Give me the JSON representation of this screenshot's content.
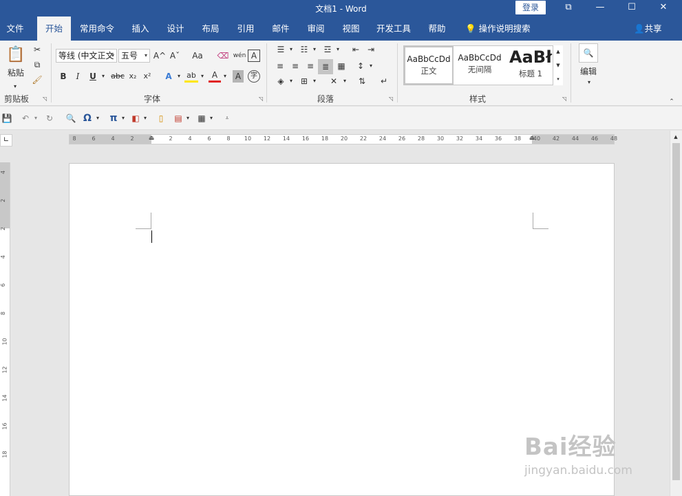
{
  "window": {
    "title": "文档1  -  Word",
    "login_label": "登录"
  },
  "window_controls": {
    "restore": "⧉",
    "minimize": "—",
    "maximize": "☐",
    "close": "✕"
  },
  "tabs": [
    "文件",
    "开始",
    "常用命令",
    "插入",
    "设计",
    "布局",
    "引用",
    "邮件",
    "审阅",
    "视图",
    "开发工具",
    "帮助"
  ],
  "tell_me": "操作说明搜索",
  "share": "共享",
  "clipboard": {
    "paste": "粘贴",
    "label": "剪贴板"
  },
  "font": {
    "name": "等线 (中文正文",
    "size": "五号",
    "label": "字体",
    "bold": "B",
    "italic": "I",
    "underline": "U",
    "strike": "abc",
    "sub": "x₂",
    "sup": "x²",
    "grow": "A^",
    "shrink": "Aˇ",
    "case": "Aa",
    "phonetic": "wén",
    "border_char": "A",
    "effects": "A",
    "highlight": "ab",
    "color": "A",
    "shade": "A",
    "enclose": "字"
  },
  "paragraph": {
    "label": "段落"
  },
  "styles": {
    "label": "样式",
    "items": [
      {
        "sample": "AaBbCcDd",
        "name": "正文"
      },
      {
        "sample": "AaBbCcDd",
        "name": "无间隔"
      },
      {
        "sample": "AaBł",
        "name": "标题 1"
      }
    ]
  },
  "editing": {
    "label": "编辑"
  },
  "colors": {
    "accent": "#2b579a",
    "ribbon_bg": "#f3f3f3",
    "workspace": "#e6e6e6"
  },
  "ruler": {
    "left_ticks": [
      "8",
      "6",
      "4",
      "2"
    ],
    "right_ticks": [
      "2",
      "4",
      "6",
      "8",
      "10",
      "12",
      "14",
      "16",
      "18",
      "20",
      "22",
      "24",
      "26",
      "28",
      "30",
      "32",
      "34",
      "36",
      "38",
      "40",
      "42",
      "44",
      "46",
      "48"
    ],
    "vertical_ticks": [
      "4",
      "2",
      "2",
      "4",
      "6",
      "8",
      "10",
      "12",
      "14",
      "16",
      "18"
    ]
  },
  "watermark": {
    "brand": "Bai经验",
    "url": "jingyan.baidu.com"
  }
}
